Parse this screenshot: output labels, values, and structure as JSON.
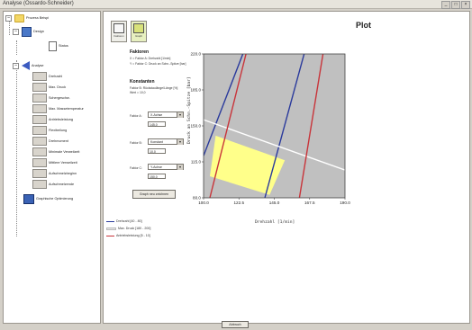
{
  "window": {
    "title": "Analyse (Ossardo-Schneider)"
  },
  "tree": {
    "root": "Prozess Beispi",
    "design": "Design",
    "status": "Status",
    "analyse": "Analyse",
    "items": [
      "Drehzahl",
      "Max. Druck",
      "Schergeschw.",
      "Max. Massetemperatur",
      "Antriebsleistung",
      "Flexibeilung",
      "Drehmoment",
      "Minimale Verweilzeit",
      "Mittlere Verweilzeit",
      "Aufschmelzbeginn",
      "Aufschmelzende"
    ],
    "graph_opt": "Graphische Optimierung"
  },
  "toolbar": {
    "btn1": "Faktoren",
    "btn2": "Graph"
  },
  "main": {
    "title": "Plot",
    "faktoren_heading": "Faktoren",
    "faktoren_x": "X = Faktor A: Drehzahl [1/min]",
    "faktoren_y": "Y = Faktor C: Druck an Schn.-Spitze [bar]",
    "konstanten_heading": "Konstanten",
    "konstanten_line1": "Faktor B: Rückstaulänge/Länge [%]",
    "konstanten_line2": "Wert = 10,0",
    "faktor_a_label": "Faktor A:",
    "faktor_a_select": "X-Achse",
    "faktor_a_value": "145,0",
    "faktor_b_label": "Faktor B:",
    "faktor_b_select": "Konstant",
    "faktor_b_value": "10,0",
    "faktor_c_label": "Faktor C:",
    "faktor_c_select": "Y-Achse",
    "faktor_c_value": "150,0",
    "draw_button": "Graph neu zeichnen",
    "cancel_button": "Abbruch"
  },
  "chart_data": {
    "type": "line",
    "xlabel": "Drehzahl [1/min]",
    "ylabel": "Druck an Schn.-Spitze [bar]",
    "xlim": [
      100,
      190
    ],
    "ylim": [
      80,
      220
    ],
    "x_ticks": [
      "100.0",
      "122.5",
      "145.0",
      "167.5",
      "190.0"
    ],
    "y_ticks": [
      "220.0",
      "185.0",
      "150.0",
      "115.0",
      "80.0"
    ],
    "series": [
      {
        "name": "Drehzahl [40 - 80]",
        "color": "#2a3a9c",
        "lines": [
          [
            [
              100,
              121
            ],
            [
              125,
              220
            ]
          ],
          [
            [
              139,
              80
            ],
            [
              164,
              220
            ]
          ]
        ]
      },
      {
        "name": "Max. Druck [180 - 200]",
        "color": "#ffffff",
        "lines": [
          [
            [
              100,
              156
            ],
            [
              190,
              107
            ]
          ]
        ]
      },
      {
        "name": "Antriebsleistung [5 - 10]",
        "color": "#c8343a",
        "lines": [
          [
            [
              104,
              80
            ],
            [
              127,
              220
            ]
          ],
          [
            [
              161,
              80
            ],
            [
              176,
              220
            ]
          ]
        ]
      }
    ],
    "feasible_region": [
      [
        104.0,
        101.0
      ],
      [
        107.7,
        140.5
      ],
      [
        151.7,
        116.5
      ],
      [
        142.0,
        82.8
      ]
    ],
    "feasible_color": "#ffff8a",
    "background": "#c0c0c0"
  }
}
